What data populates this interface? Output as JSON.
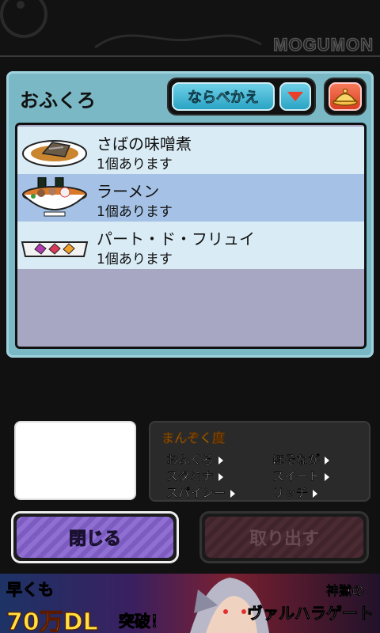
{
  "header": {
    "logo": "MOGUMON"
  },
  "panel": {
    "title": "おふくろ",
    "sort_label": "ならべかえ",
    "dropdown_icon": "triangle-down-icon",
    "dish_icon": "cloche-icon"
  },
  "items": [
    {
      "name": "さばの味噌煮",
      "count": "1個あります",
      "icon": "saba-miso-dish-icon"
    },
    {
      "name": "ラーメン",
      "count": "1個あります",
      "icon": "ramen-bowl-icon"
    },
    {
      "name": "パート・ド・フリュイ",
      "count": "1個あります",
      "icon": "pate-de-fruit-tray-icon"
    }
  ],
  "stats": {
    "title": "まんぞく度",
    "items": [
      {
        "label": "おふくろ"
      },
      {
        "label": "ほそなが"
      },
      {
        "label": "スタミナ"
      },
      {
        "label": "スイート"
      },
      {
        "label": "スパイシー"
      },
      {
        "label": "リッチ"
      }
    ]
  },
  "buttons": {
    "close": "閉じる",
    "take_out": "取り出す"
  },
  "ad": {
    "line1": "早くも",
    "line2": "70万DL",
    "line2_suffix": "突破！",
    "title1": "神獄の",
    "title2": "ヴァルハラゲート"
  },
  "colors": {
    "panel": "#7ab8c6",
    "list_bg": "#a7a7c3",
    "row_light": "#d9ebf5",
    "row_selected": "#a5c2e6",
    "sort_button": "#2aa4c4",
    "dropdown_arrow": "#e8402a",
    "close_button": "#8f6fd1",
    "take_out_button_disabled": "#4a2a33",
    "stats_title": "#f0c040"
  }
}
